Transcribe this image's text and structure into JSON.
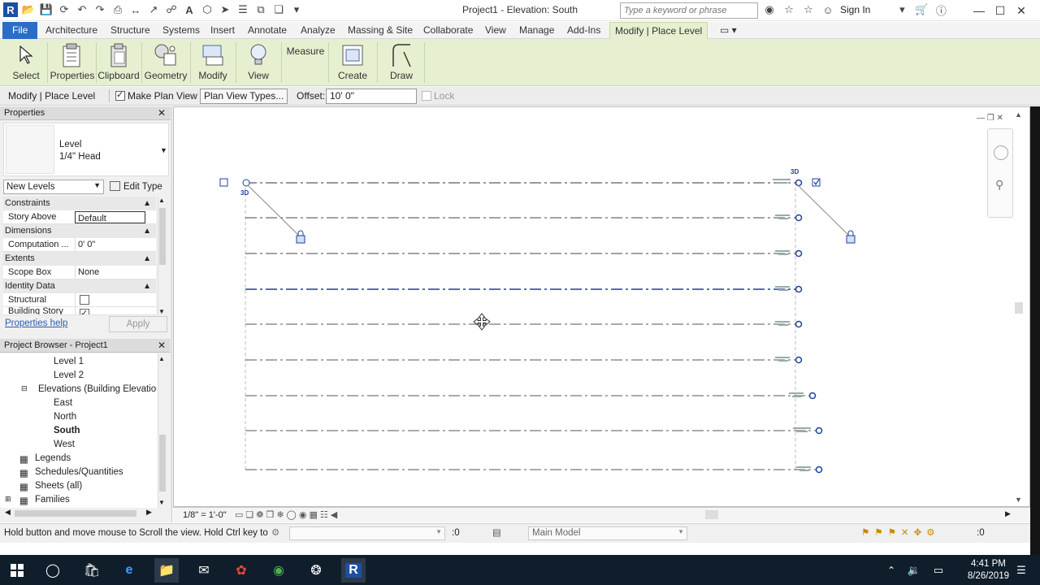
{
  "titlebar": {
    "title": "Project1 - Elevation: South",
    "search_placeholder": "Type a keyword or phrase",
    "sign_in": "Sign In"
  },
  "menu": {
    "file": "File",
    "tabs": [
      "Architecture",
      "Structure",
      "Systems",
      "Insert",
      "Annotate",
      "Analyze",
      "Massing & Site",
      "Collaborate",
      "View",
      "Manage",
      "Add-Ins",
      "Modify | Place Level"
    ]
  },
  "ribbon": {
    "select": "Select",
    "properties": "Properties",
    "clipboard": "Clipboard",
    "geometry": "Geometry",
    "modify": "Modify",
    "view": "View",
    "measure": "Measure",
    "create": "Create",
    "draw": "Draw"
  },
  "options": {
    "context": "Modify | Place Level",
    "make_plan_view": "Make Plan View",
    "plan_view_types": "Plan View Types...",
    "offset_label": "Offset:",
    "offset_value": "10'  0\"",
    "lock": "Lock"
  },
  "properties": {
    "header": "Properties",
    "type_family": "Level",
    "type_name": "1/4\" Head",
    "selector": "New Levels",
    "edit_type": "Edit Type",
    "groups": {
      "constraints": "Constraints",
      "dimensions": "Dimensions",
      "extents": "Extents",
      "identity": "Identity Data"
    },
    "rows": {
      "story_above_k": "Story Above",
      "story_above_v": "Default",
      "computation_k": "Computation ...",
      "computation_v": "0'  0\"",
      "scope_box_k": "Scope Box",
      "scope_box_v": "None",
      "structural_k": "Structural",
      "building_story_k": "Building Story"
    },
    "help": "Properties help",
    "apply": "Apply"
  },
  "browser": {
    "header": "Project Browser - Project1",
    "items": {
      "level1": "Level 1",
      "level2": "Level 2",
      "elevations": "Elevations (Building Elevation",
      "east": "East",
      "north": "North",
      "south": "South",
      "west": "West",
      "legends": "Legends",
      "schedules": "Schedules/Quantities",
      "sheets": "Sheets (all)",
      "families": "Families"
    }
  },
  "canvas": {
    "tag_3d_left": "3D",
    "tag_3d_right": "3D"
  },
  "viewbar": {
    "scale": "1/8\" = 1'-0\""
  },
  "status": {
    "message": "Hold button and move mouse to Scroll the view. Hold Ctrl key to",
    "worksets": ":0",
    "model": "Main Model",
    "filter": ":0"
  },
  "taskbar": {
    "time": "4:41 PM",
    "date": "8/26/2019"
  },
  "colors": {
    "ribbon": "#e6f0d0",
    "file_tab": "#2b6cc7",
    "level_selected": "#1f3f9e",
    "taskbar": "#101e2c"
  }
}
